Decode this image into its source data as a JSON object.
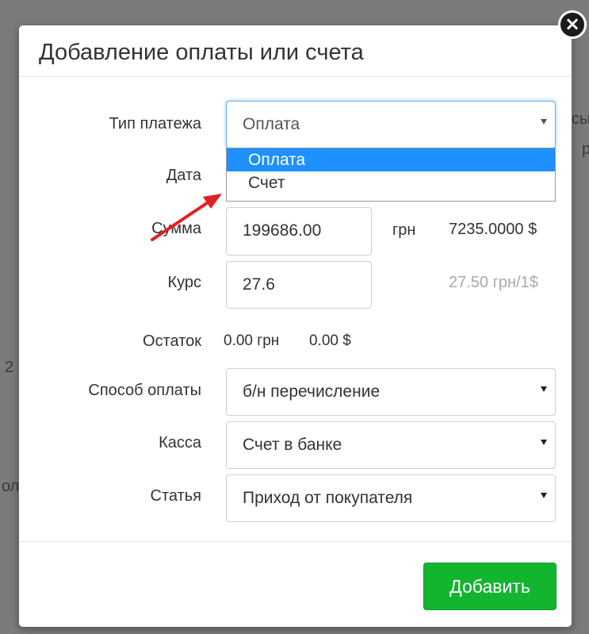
{
  "background": {
    "fragments": [
      "сы",
      "р",
      "2",
      "ол"
    ]
  },
  "modal": {
    "title": "Добавление оплаты или счета",
    "close_glyph": "×",
    "fields": {
      "payment_type": {
        "label": "Тип платежа",
        "value": "Оплата"
      },
      "date": {
        "label": "Дата"
      },
      "amount": {
        "label": "Сумма",
        "value": "199686.00",
        "currency": "грн",
        "converted": "7235.0000 $"
      },
      "rate": {
        "label": "Курс",
        "value": "27.6",
        "hint": "27.50 грн/1$"
      },
      "balance": {
        "label": "Остаток",
        "uah": "0.00 грн",
        "usd": "0.00 $"
      },
      "payment_method": {
        "label": "Способ оплаты",
        "value": "б/н перечисление"
      },
      "cashbox": {
        "label": "Касса",
        "value": "Счет в банке"
      },
      "article": {
        "label": "Статья",
        "value": "Приход от покупателя"
      }
    },
    "dropdown_options": [
      "Оплата",
      "Счет"
    ],
    "submit_label": "Добавить"
  },
  "colors": {
    "accent": "#1e90ff",
    "submit": "#13b52f",
    "arrow": "#e02020"
  }
}
